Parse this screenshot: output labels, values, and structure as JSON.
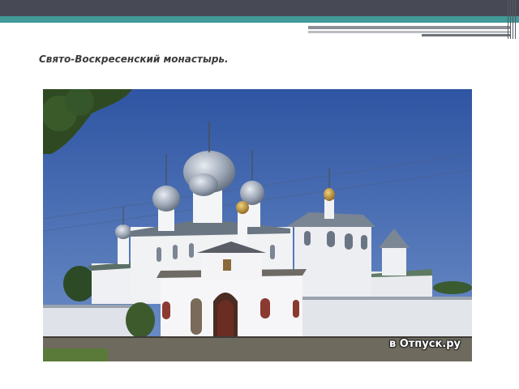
{
  "slide": {
    "title": "Свято-Воскресенский монастырь."
  },
  "photo": {
    "subject": "monastery-photo",
    "watermark": "в Отпуск.ру"
  },
  "colors": {
    "header_dark": "#474a54",
    "header_teal": "#3f9a98",
    "sky": "#3b5fa6"
  }
}
